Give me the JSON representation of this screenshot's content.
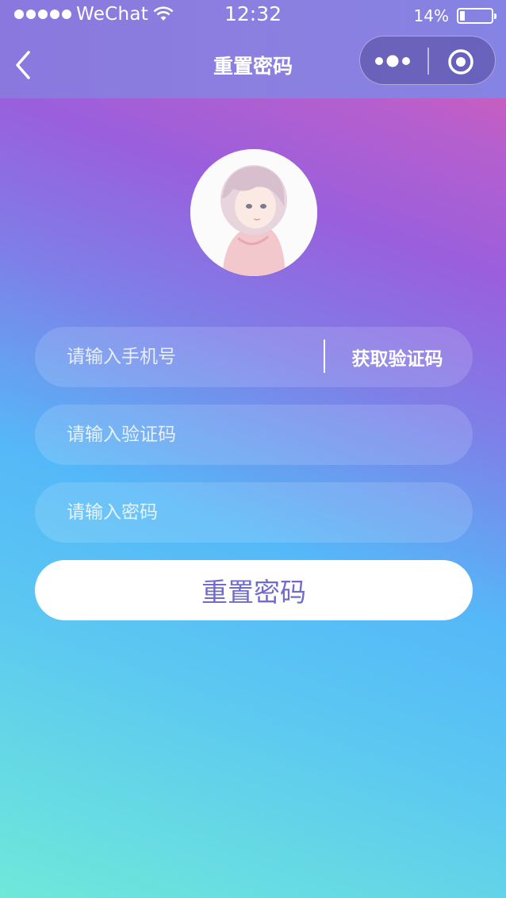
{
  "status_bar": {
    "carrier": "WeChat",
    "time": "12:32",
    "battery_percent": "14%",
    "battery_level": 0.14
  },
  "nav": {
    "title": "重置密码",
    "back_icon": "chevron-left-icon",
    "more_icon": "more-dots-icon",
    "close_icon": "target-close-icon"
  },
  "avatar": {
    "icon": "user-avatar-illustration"
  },
  "form": {
    "phone_placeholder": "请输入手机号",
    "get_code_label": "获取验证码",
    "code_placeholder": "请输入验证码",
    "password_placeholder": "请输入密码",
    "submit_label": "重置密码"
  },
  "colors": {
    "gradient_top_right": "#e95ba8",
    "gradient_mid": "#9a5fdc",
    "gradient_blue": "#55b8f8",
    "gradient_bottom_left": "#6fe8d9",
    "submit_text": "#6f6bd0"
  }
}
